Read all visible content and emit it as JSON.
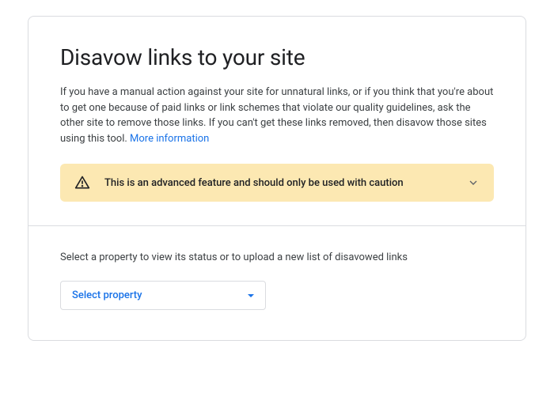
{
  "title": "Disavow links to your site",
  "description": "If you have a manual action against your site for unnatural links, or if you think that you're about to get one because of paid links or link schemes that violate our quality guidelines, ask the other site to remove those links. If you can't get these links removed, then disavow those sites using this tool.",
  "more_link_label": "More information",
  "warning": {
    "text": "This is an advanced feature and should only be used with caution"
  },
  "property_section": {
    "instruction": "Select a property to view its status or to upload a new list of disavowed links",
    "select_label": "Select property"
  }
}
